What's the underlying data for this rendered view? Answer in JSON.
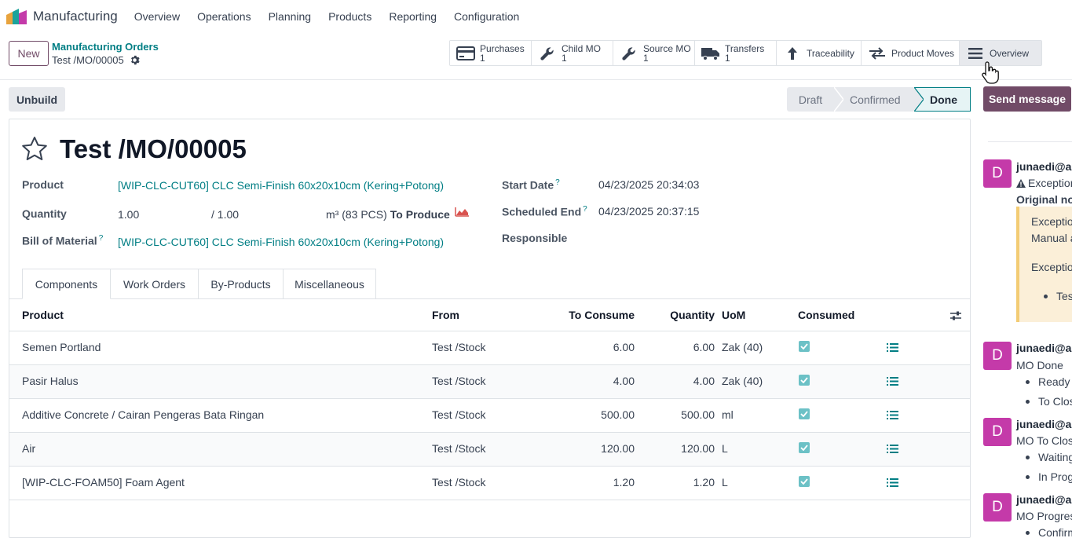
{
  "navbar": {
    "app_name": "Manufacturing",
    "menu": [
      "Overview",
      "Operations",
      "Planning",
      "Products",
      "Reporting",
      "Configuration"
    ]
  },
  "control": {
    "new_label": "New",
    "breadcrumb_parent": "Manufacturing Orders",
    "breadcrumb_current": "Test /MO/00005",
    "smart_buttons": [
      {
        "label": "Purchases",
        "count": "1",
        "icon": "credit-card-icon"
      },
      {
        "label": "Child MO",
        "count": "1",
        "icon": "wrench-icon"
      },
      {
        "label": "Source MO",
        "count": "1",
        "icon": "wrench-icon"
      },
      {
        "label": "Transfers",
        "count": "1",
        "icon": "truck-icon"
      },
      {
        "label": "Traceability",
        "icon": "arrow-up-icon"
      },
      {
        "label": "Product Moves",
        "icon": "exchange-icon"
      },
      {
        "label": "Overview",
        "icon": "bars-icon"
      }
    ]
  },
  "actions": {
    "unbuild_label": "Unbuild",
    "send_message_label": "Send message"
  },
  "statusbar": {
    "stages": [
      "Draft",
      "Confirmed",
      "Done"
    ],
    "current": "Done"
  },
  "form": {
    "title": "Test /MO/00005",
    "product_label": "Product",
    "product_value": "[WIP-CLC-CUT60] CLC Semi-Finish 60x20x10cm (Kering+Potong)",
    "quantity_label": "Quantity",
    "quantity_value": "1.00",
    "quantity_produced": "/ 1.00",
    "quantity_uom": "m³ (83 PCS)",
    "to_produce": "To Produce",
    "bom_label": "Bill of Material",
    "bom_value": "[WIP-CLC-CUT60] CLC Semi-Finish 60x20x10cm (Kering+Potong)",
    "start_date_label": "Start Date",
    "start_date_value": "04/23/2025 20:34:03",
    "scheduled_end_label": "Scheduled End",
    "scheduled_end_value": "04/23/2025 20:37:15",
    "responsible_label": "Responsible",
    "help_mark": "?"
  },
  "tabs": [
    "Components",
    "Work Orders",
    "By-Products",
    "Miscellaneous"
  ],
  "components": {
    "headers": {
      "product": "Product",
      "from": "From",
      "to_consume": "To Consume",
      "quantity": "Quantity",
      "uom": "UoM",
      "consumed": "Consumed"
    },
    "rows": [
      {
        "product": "Semen Portland",
        "from": "Test /Stock",
        "to_consume": "6.00",
        "quantity": "6.00",
        "uom": "Zak (40)",
        "consumed": true
      },
      {
        "product": "Pasir Halus",
        "from": "Test /Stock",
        "to_consume": "4.00",
        "quantity": "4.00",
        "uom": "Zak (40)",
        "consumed": true
      },
      {
        "product": "Additive Concrete / Cairan Pengeras Bata Ringan",
        "from": "Test /Stock",
        "to_consume": "500.00",
        "quantity": "500.00",
        "uom": "ml",
        "consumed": true
      },
      {
        "product": "Air",
        "from": "Test /Stock",
        "to_consume": "120.00",
        "quantity": "120.00",
        "uom": "L",
        "consumed": true
      },
      {
        "product": "[WIP-CLC-FOAM50] Foam Agent",
        "from": "Test /Stock",
        "to_consume": "1.20",
        "quantity": "1.20",
        "uom": "L",
        "consumed": true
      }
    ]
  },
  "chatter": {
    "avatar_letter": "D",
    "messages": [
      {
        "author": "junaedi@ap",
        "lines": [
          "Exception",
          "Original no"
        ],
        "box": [
          "Exceptio",
          "Manual a",
          "Exceptio",
          "Tes"
        ]
      },
      {
        "author": "junaedi@ap",
        "lines": [
          "MO Done"
        ],
        "bullets": [
          "Ready",
          "To Clos"
        ]
      },
      {
        "author": "junaedi@ap",
        "lines": [
          "MO To Clos"
        ],
        "bullets": [
          "Waiting",
          "In Prog"
        ]
      },
      {
        "author": "junaedi@ap",
        "lines": [
          "MO Progres"
        ],
        "bullets": [
          "Confirm"
        ]
      }
    ]
  },
  "colors": {
    "brand": "#714b67",
    "link": "#017e84",
    "avatar": "#c43aa9",
    "checkbox": "#6cc1c6"
  }
}
